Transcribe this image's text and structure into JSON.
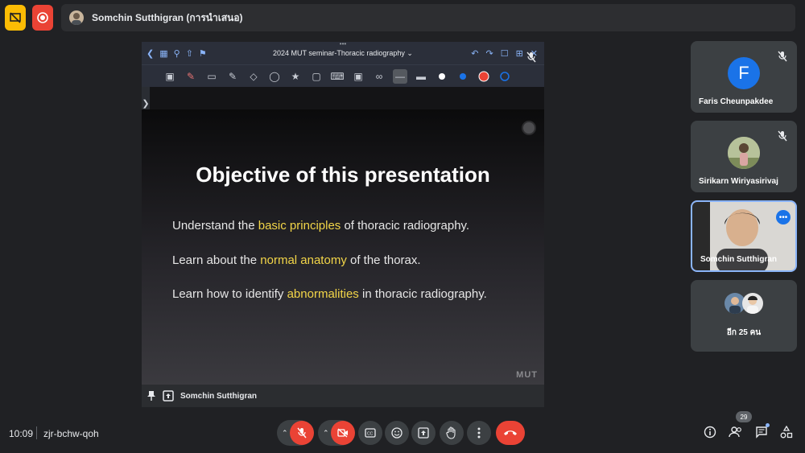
{
  "top_bar": {
    "presenter_name": "Somchin Sutthigran (การนำเสนอ)"
  },
  "shared_screen": {
    "document_title": "2024 MUT seminar-Thoracic radiography ⌄",
    "footer_presenter": "Somchin Sutthigran",
    "slide": {
      "title": "Objective of this presentation",
      "bullets": [
        {
          "pre": "Understand the ",
          "hl": "basic principles",
          "post": " of thoracic radiography."
        },
        {
          "pre": "Learn about the ",
          "hl": "normal anatomy",
          "post": " of the thorax."
        },
        {
          "pre": "Learn how to identify ",
          "hl": "abnormalities",
          "post": " in thoracic radiography."
        }
      ],
      "logo_text": "MUT"
    }
  },
  "participants": [
    {
      "name": "Faris Cheunpakdee",
      "initial": "F",
      "avatar_color": "#1a73e8"
    },
    {
      "name": "Sirikarn Wiriyasirivaj"
    },
    {
      "name": "Somchin Sutthigran"
    },
    {
      "name": "อีก 25 คน"
    }
  ],
  "bottom_bar": {
    "time": "10:09",
    "meeting_code": "zjr-bchw-qoh",
    "people_count": "29"
  },
  "colors": {
    "end_call": "#ea4335",
    "accent": "#8ab4f8",
    "highlight": "#f2d548"
  }
}
